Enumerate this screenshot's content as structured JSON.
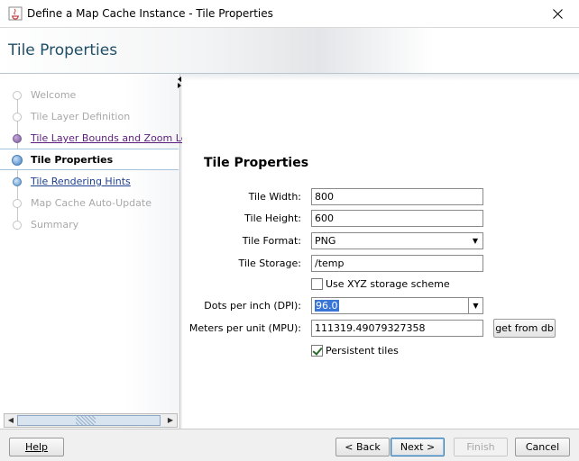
{
  "window": {
    "title": "Define a Map Cache Instance - Tile Properties",
    "close_icon": "close-icon"
  },
  "header": {
    "title": "Tile Properties"
  },
  "nav": {
    "items": [
      {
        "label": "Welcome",
        "state": "disabled"
      },
      {
        "label": "Tile Layer Definition",
        "state": "disabled"
      },
      {
        "label": "Tile Layer Bounds and Zoom Levels",
        "state": "visited"
      },
      {
        "label": "Tile Properties",
        "state": "current"
      },
      {
        "label": "Tile Rendering Hints",
        "state": "link"
      },
      {
        "label": "Map Cache Auto-Update",
        "state": "disabled"
      },
      {
        "label": "Summary",
        "state": "disabled"
      }
    ]
  },
  "form": {
    "section_title": "Tile Properties",
    "tile_width_label": "Tile Width:",
    "tile_width_value": "800",
    "tile_height_label": "Tile Height:",
    "tile_height_value": "600",
    "tile_format_label": "Tile Format:",
    "tile_format_value": "PNG",
    "tile_storage_label": "Tile Storage:",
    "tile_storage_value": "/temp",
    "xyz_label": "Use XYZ storage scheme",
    "xyz_checked": false,
    "dpi_label": "Dots per inch (DPI):",
    "dpi_value": "96.0",
    "mpu_label": "Meters per unit (MPU):",
    "mpu_value": "111319.49079327358",
    "get_from_db_label": "get from db",
    "persistent_label": "Persistent tiles",
    "persistent_checked": true
  },
  "footer": {
    "help_label": "Help",
    "back_label": "< Back",
    "next_label": "Next >",
    "finish_label": "Finish",
    "cancel_label": "Cancel"
  }
}
